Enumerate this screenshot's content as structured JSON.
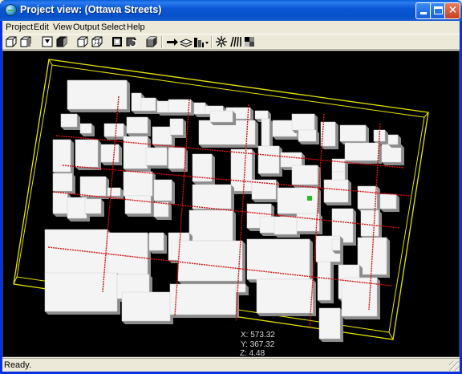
{
  "window": {
    "title": "Project view: (Ottawa Streets)",
    "minimize_glyph": "",
    "maximize_glyph": "",
    "close_glyph": "✕"
  },
  "menu": [
    {
      "label": "Project"
    },
    {
      "label": "Edit"
    },
    {
      "label": "View"
    },
    {
      "label": "Output"
    },
    {
      "label": "Select"
    },
    {
      "label": "Help"
    }
  ],
  "toolbar": {
    "tools": [
      {
        "icon": "view-front-cube-icon"
      },
      {
        "icon": "view-side-cube-icon"
      },
      {
        "icon": "view-top-cube-icon"
      },
      {
        "icon": "solid-cube-icon"
      },
      {
        "icon": "wireframe-cube-icon"
      },
      {
        "icon": "wireframe-cube-alt-icon"
      },
      {
        "icon": "render-icon"
      },
      {
        "icon": "rotate-render-icon"
      },
      {
        "icon": "shaded-cube-icon"
      },
      {
        "icon": "move-right-icon"
      },
      {
        "icon": "layers-icon"
      },
      {
        "icon": "buildings-dropdown-icon"
      },
      {
        "icon": "light-burst-icon"
      },
      {
        "icon": "rays-icon"
      },
      {
        "icon": "texture-icon"
      }
    ]
  },
  "viewport": {
    "background": "#000000",
    "bounding_box_color": "#e6e600",
    "street_color": "#d01010",
    "building_top_color": "#f4f4f4",
    "building_side_color": "#8c8c8c",
    "marker_color": "#22c022"
  },
  "coordinates": {
    "x": "X: 573.32",
    "y": "Y: 367.32",
    "z": "Z: 4.48"
  },
  "status": {
    "text": "Ready."
  }
}
